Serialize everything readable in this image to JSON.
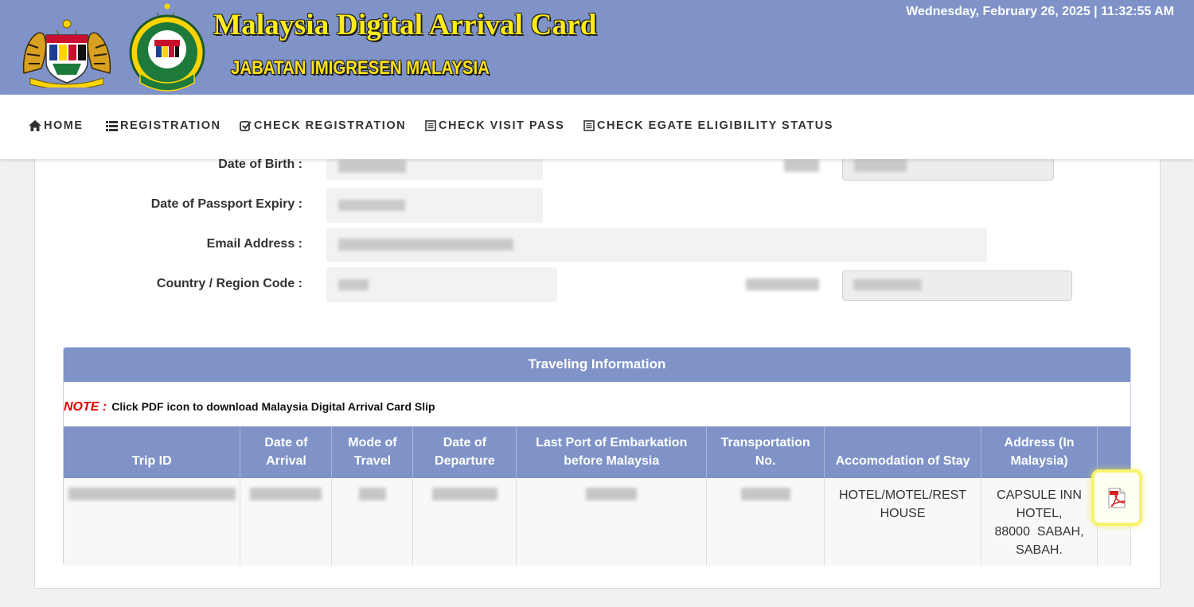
{
  "header": {
    "title": "Malaysia Digital Arrival Card",
    "subtitle": "JABATAN IMIGRESEN MALAYSIA",
    "datetime": "Wednesday, February 26, 2025 | 11:32:55 AM",
    "crest_icon": "malaysia-coat-of-arms",
    "logo_icon": "imigresen-malaysia-emblem",
    "brand_color": "#7f93c8",
    "title_color": "#ffeb1a"
  },
  "nav": {
    "items": [
      {
        "label": "HOME",
        "icon": "home-icon"
      },
      {
        "label": "REGISTRATION",
        "icon": "list-icon"
      },
      {
        "label": "CHECK REGISTRATION",
        "icon": "check-square-icon"
      },
      {
        "label": "CHECK VISIT PASS",
        "icon": "document-icon"
      },
      {
        "label": "CHECK EGATE ELIGIBILITY STATUS",
        "icon": "document-icon"
      }
    ]
  },
  "form": {
    "dob_label": "Date of Birth :",
    "passport_expiry_label": "Date of Passport Expiry :",
    "email_label": "Email Address :",
    "country_code_label": "Country / Region Code :"
  },
  "travel": {
    "heading": "Traveling Information",
    "note_key": "NOTE :",
    "note_text": "Click PDF icon to download Malaysia Digital Arrival Card Slip",
    "columns": [
      "Trip ID",
      "Date of Arrival",
      "Mode of Travel",
      "Date of Departure",
      "Last Port of Embarkation before Malaysia",
      "Transportation No.",
      "Accomodation of Stay",
      "Address (In Malaysia)",
      ""
    ],
    "columns_split": {
      "c1": [
        "Date of",
        "Arrival"
      ],
      "c2": [
        "Mode of",
        "Travel"
      ],
      "c3": [
        "Date of",
        "Departure"
      ],
      "c4": [
        "Last Port of Embarkation",
        "before Malaysia"
      ],
      "c5": [
        "Transportation",
        "No."
      ],
      "c7": [
        "Address (In",
        "Malaysia)"
      ]
    },
    "row": {
      "accommodation": [
        "HOTEL/MOTEL/REST",
        "HOUSE"
      ],
      "address": [
        "CAPSULE INN",
        "HOTEL,",
        "88000  SABAH,",
        "SABAH."
      ],
      "pdf_icon": "pdf-icon",
      "highlight_color": "#f7f46b"
    }
  }
}
